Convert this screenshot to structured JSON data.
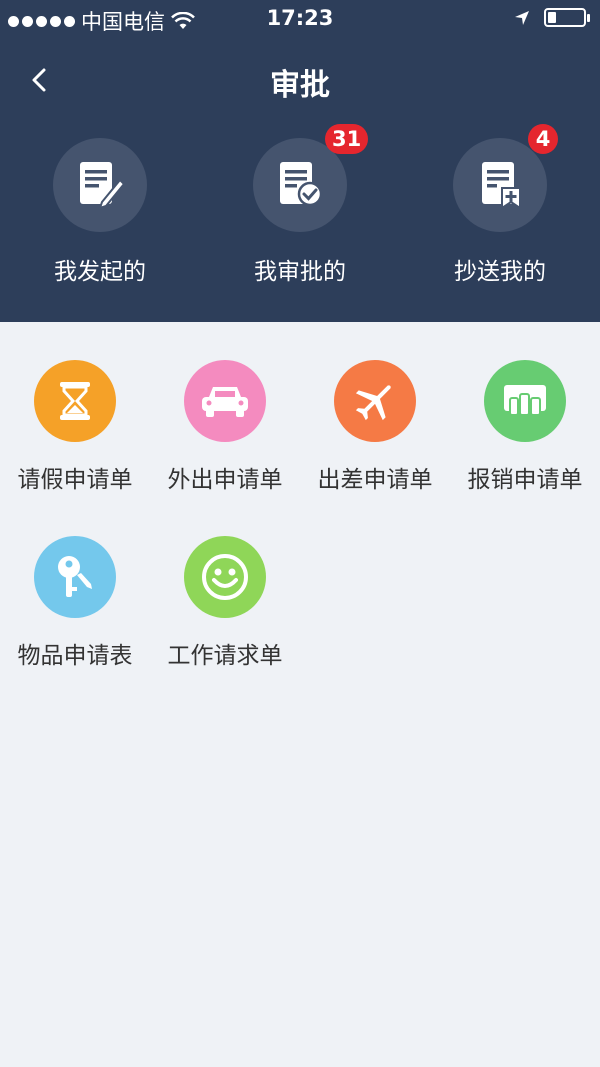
{
  "status_bar": {
    "carrier": "中国电信",
    "time": "17:23"
  },
  "nav": {
    "title": "审批"
  },
  "top_tabs": [
    {
      "label": "我发起的",
      "badge": "",
      "icon": "edit-document-icon"
    },
    {
      "label": "我审批的",
      "badge": "31",
      "icon": "approved-document-icon"
    },
    {
      "label": "抄送我的",
      "badge": "4",
      "icon": "cc-document-icon"
    }
  ],
  "apps": [
    {
      "label": "请假申请单",
      "icon": "hourglass-icon",
      "color": "#f5a128"
    },
    {
      "label": "外出申请单",
      "icon": "car-icon",
      "color": "#f48bbf"
    },
    {
      "label": "出差申请单",
      "icon": "airplane-icon",
      "color": "#f57a45"
    },
    {
      "label": "报销申请单",
      "icon": "reimbursement-icon",
      "color": "#67cc72"
    },
    {
      "label": "物品申请表",
      "icon": "key-icon",
      "color": "#74c8ec"
    },
    {
      "label": "工作请求单",
      "icon": "smiley-icon",
      "color": "#8fd658"
    }
  ],
  "colors": {
    "header_bg": "#2d3e5a",
    "page_bg": "#eff2f6",
    "badge": "#e5262e"
  }
}
